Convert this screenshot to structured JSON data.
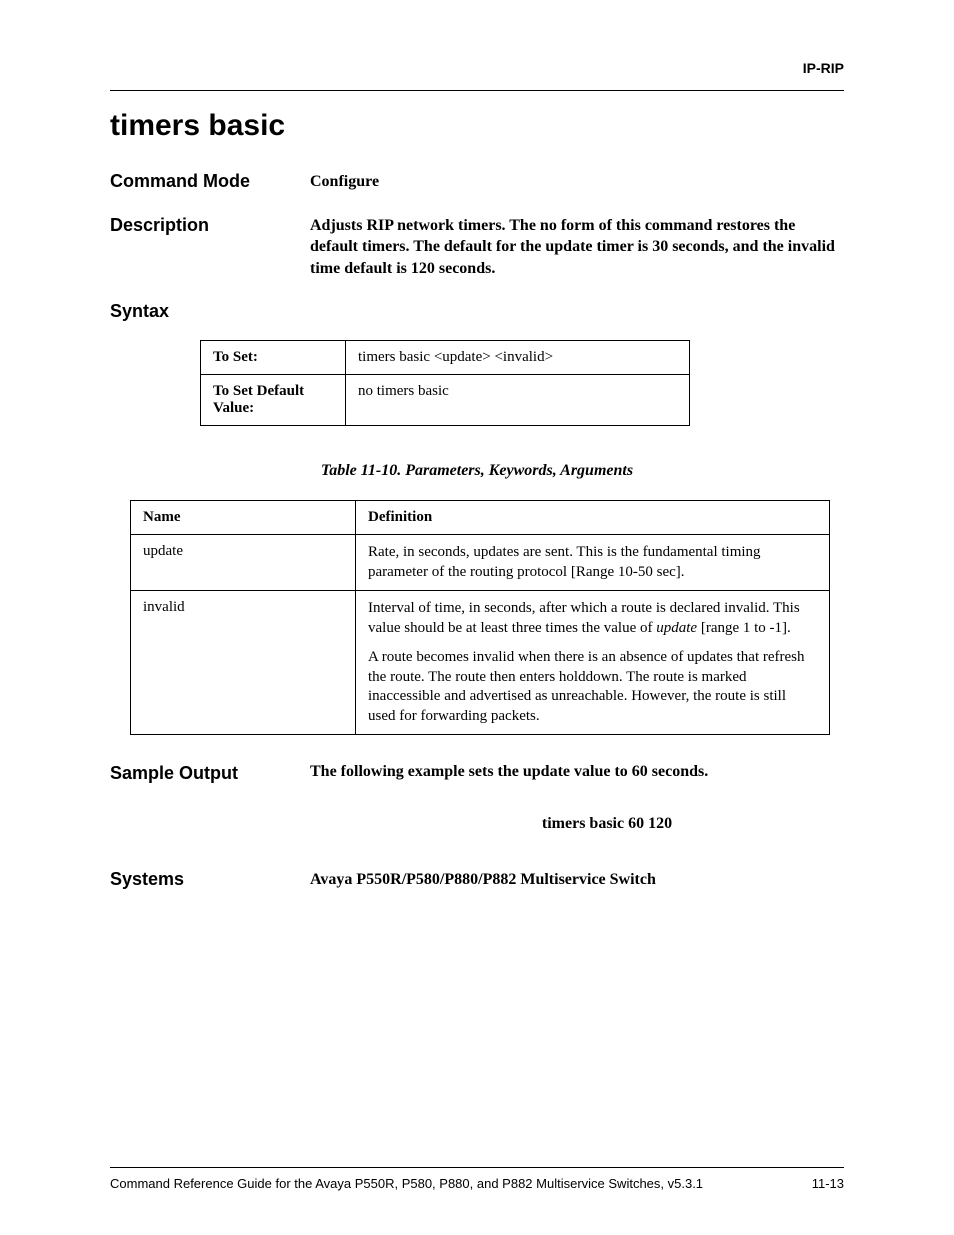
{
  "header": {
    "right": "IP-RIP"
  },
  "title": "timers basic",
  "sections": {
    "commandMode": {
      "label": "Command Mode",
      "value": "Configure"
    },
    "description": {
      "label": "Description",
      "value": "Adjusts RIP network timers. The no form of this command restores the default timers. The default for the update timer is 30 seconds, and the invalid time default is 120 seconds."
    },
    "syntax": {
      "label": "Syntax"
    },
    "sampleOutput": {
      "label": "Sample Output",
      "intro": "The following example sets the update value to 60 seconds.",
      "code": "timers basic 60 120"
    },
    "systems": {
      "label": "Systems",
      "value": "Avaya P550R/P580/P880/P882 Multiservice Switch"
    }
  },
  "syntaxTable": {
    "rows": [
      {
        "label": "To Set:",
        "value": "timers basic <update> <invalid>"
      },
      {
        "label": "To Set Default Value:",
        "value": "no timers basic"
      }
    ]
  },
  "paramsTable": {
    "caption": "Table 11-10.  Parameters, Keywords, Arguments",
    "headers": {
      "name": "Name",
      "definition": "Definition"
    },
    "rows": [
      {
        "name": "update",
        "p1": "Rate, in seconds, updates are sent. This is the fundamental timing parameter of the routing protocol [Range 10-50 sec]."
      },
      {
        "name": "invalid",
        "p1_pre": "Interval of time, in seconds, after which a route is declared invalid. This value should be at least three times the value of ",
        "p1_it": "update",
        "p1_post": " [range 1 to -1].",
        "p2": "A route becomes invalid when there is an absence of updates that refresh the route. The route then enters holddown. The route is marked inaccessible and advertised as unreachable. However, the route is still used for forwarding packets."
      }
    ]
  },
  "footer": {
    "left": "Command Reference Guide for the Avaya P550R, P580, P880, and P882 Multiservice Switches, v5.3.1",
    "right": "11-13"
  }
}
